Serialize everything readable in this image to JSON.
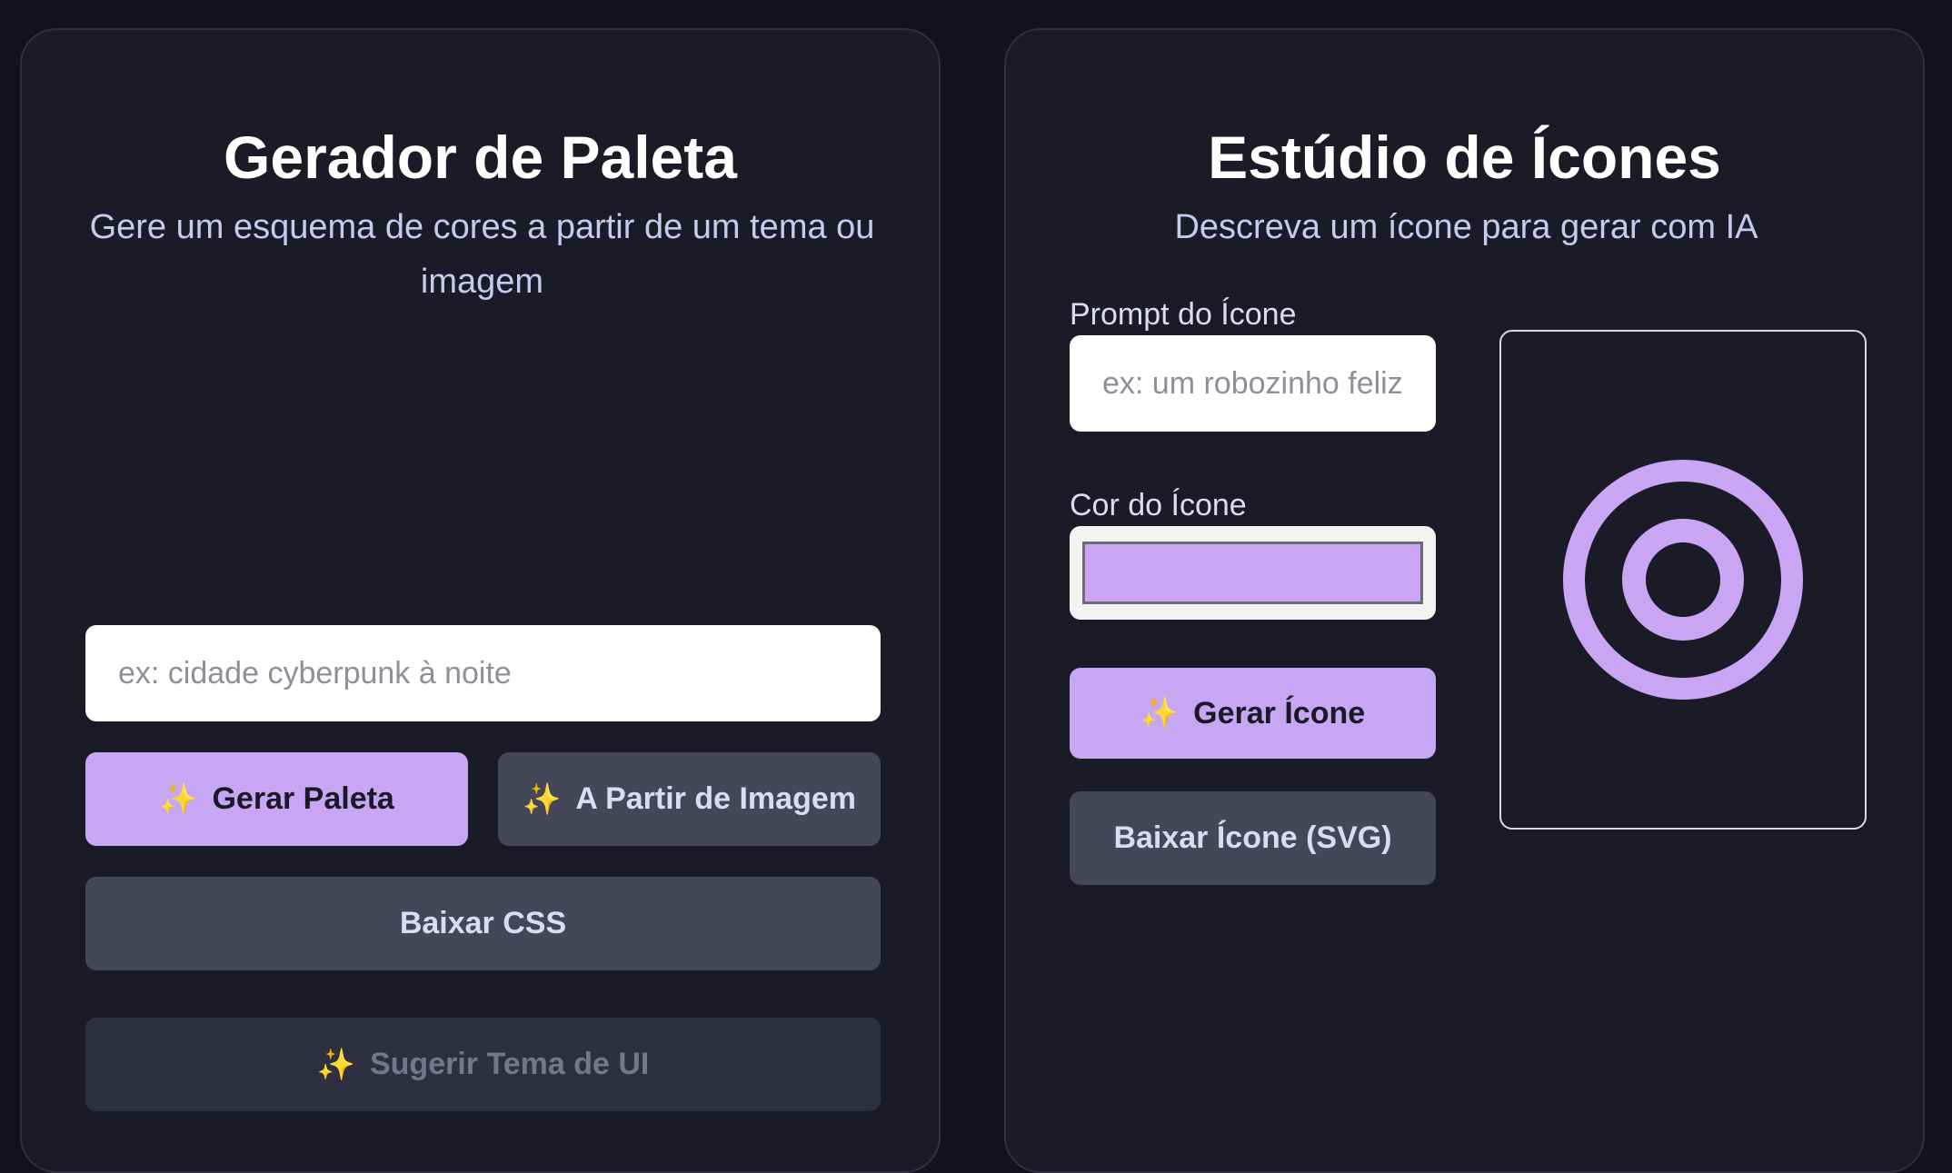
{
  "palette": {
    "title": "Gerador de Paleta",
    "subtitle": "Gere um esquema de cores a partir de um tema ou imagem",
    "theme_input_placeholder": "ex: cidade cyberpunk à noite",
    "generate_button": "Gerar Paleta",
    "from_image_button": "A Partir de Imagem",
    "download_css_button": "Baixar CSS",
    "suggest_theme_button": "Sugerir Tema de UI",
    "sparkle_glyph": "✨"
  },
  "icon_studio": {
    "title": "Estúdio de Ícones",
    "subtitle": "Descreva um ícone para gerar com IA",
    "prompt_label": "Prompt do Ícone",
    "prompt_placeholder": "ex: um robozinho feliz",
    "color_label": "Cor do Ícone",
    "color_value": "#c8a6f4",
    "generate_button": "Gerar Ícone",
    "download_button": "Baixar Ícone (SVG)",
    "preview_icon": "target-icon"
  },
  "colors": {
    "accent": "#c7a6f4",
    "secondary_button": "#454759",
    "panel_bg": "#1b1b28",
    "page_bg": "#12121c"
  }
}
